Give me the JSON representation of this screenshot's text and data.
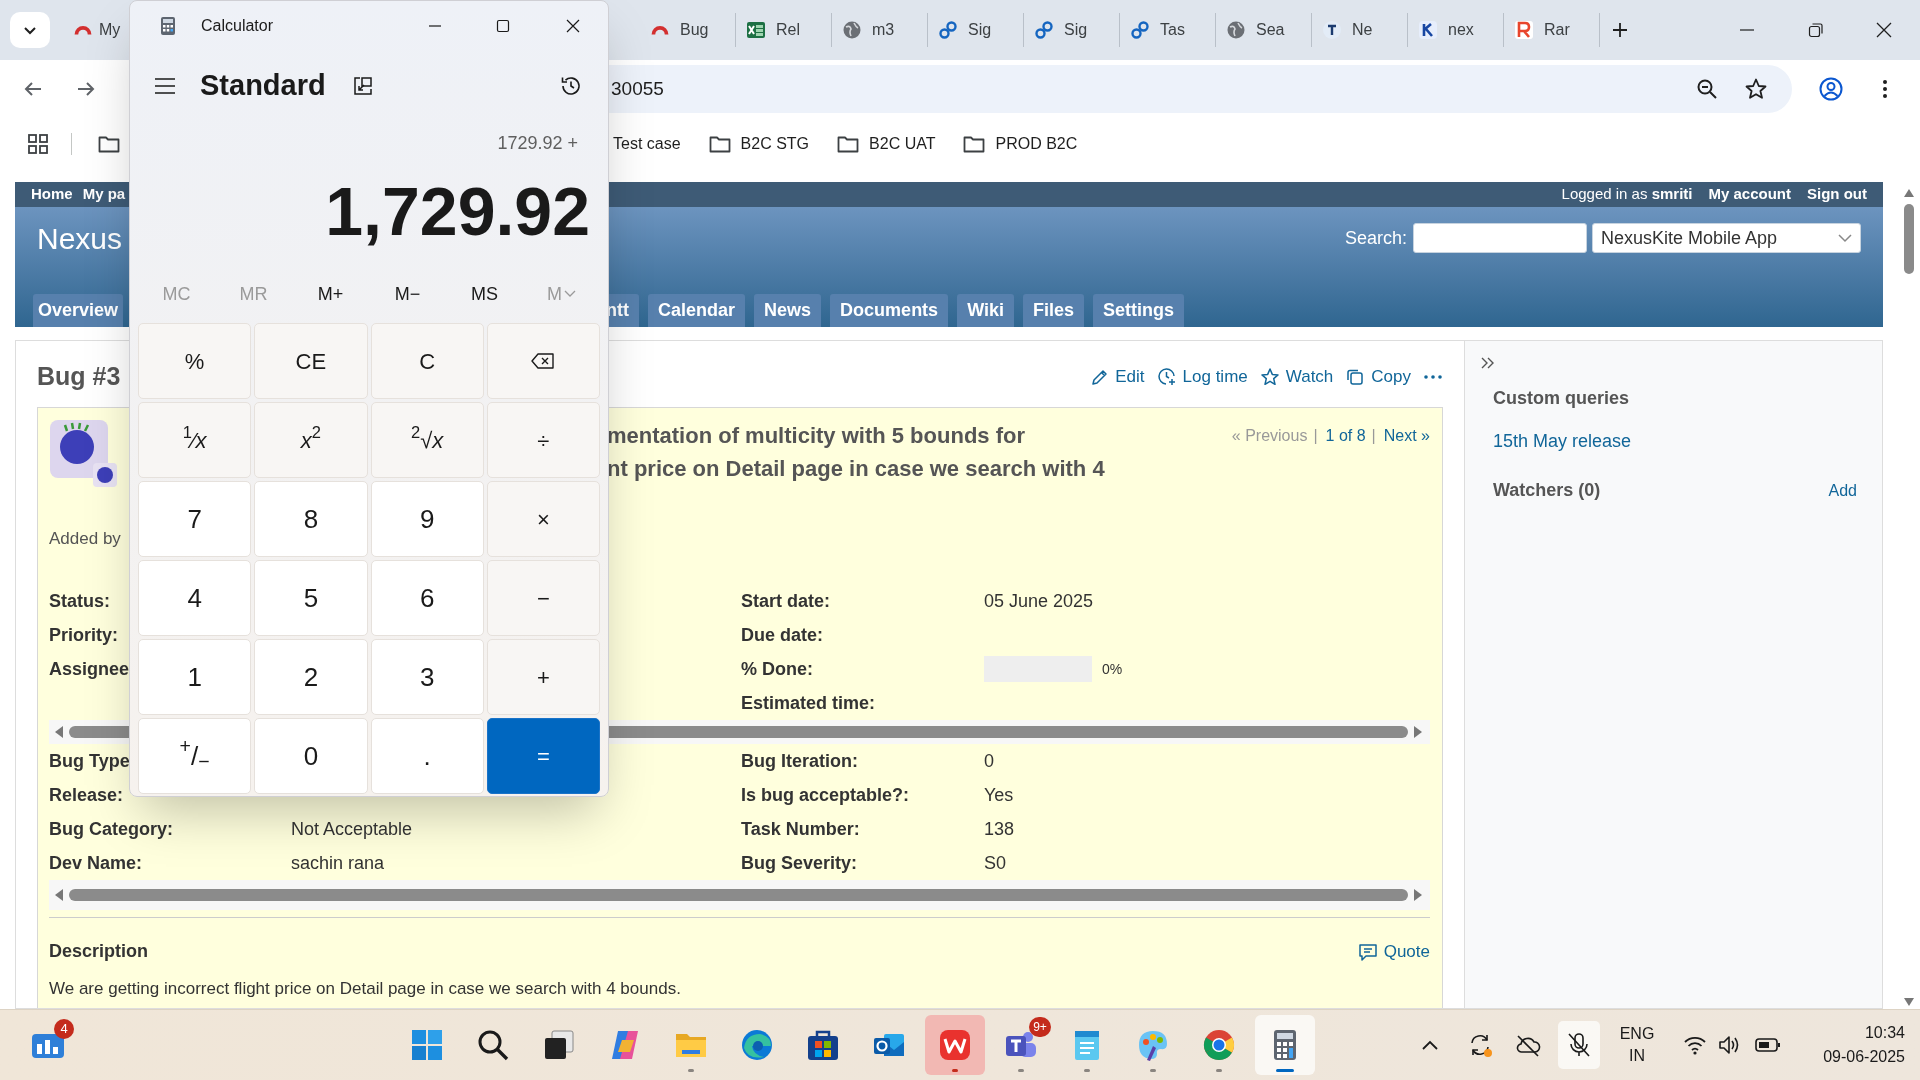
{
  "browser": {
    "tabs": [
      {
        "label": "My",
        "kind": "arch",
        "selected": false
      },
      {
        "label": "Bug",
        "kind": "arch",
        "selected": false
      },
      {
        "label": "Rel",
        "kind": "sheet",
        "selected": false
      },
      {
        "label": "m3",
        "kind": "globe",
        "selected": false
      },
      {
        "label": "Sig",
        "kind": "link",
        "selected": false
      },
      {
        "label": "Sig",
        "kind": "link",
        "selected": false
      },
      {
        "label": "Tas",
        "kind": "link",
        "selected": false
      },
      {
        "label": "Sea",
        "kind": "globe",
        "selected": false
      },
      {
        "label": "Ne",
        "kind": "navy",
        "selected": false
      },
      {
        "label": "nex",
        "kind": "blue",
        "selected": false
      },
      {
        "label": "Rar",
        "kind": "red",
        "selected": false
      }
    ],
    "address": "30055",
    "bookmarks": [
      {
        "label": "Test case",
        "kind": "plain"
      },
      {
        "label": "B2C STG",
        "kind": "folder"
      },
      {
        "label": "B2C UAT",
        "kind": "folder"
      },
      {
        "label": "PROD B2C",
        "kind": "folder"
      }
    ]
  },
  "redmine": {
    "top_menu": [
      "Home",
      "My pa"
    ],
    "logged_in": "Logged in as **smriti**",
    "account_links": [
      "My account",
      "Sign out"
    ],
    "project_title": "Nexus",
    "search_label": "Search:",
    "project_select": "NexusKite Mobile App",
    "tabs": [
      {
        "label": "Overview",
        "selected": false
      },
      {
        "label": "ntt",
        "selected": false
      },
      {
        "label": "Calendar",
        "selected": false
      },
      {
        "label": "News",
        "selected": false
      },
      {
        "label": "Documents",
        "selected": false
      },
      {
        "label": "Wiki",
        "selected": false
      },
      {
        "label": "Files",
        "selected": false
      },
      {
        "label": "Settings",
        "selected": false
      }
    ],
    "issue": {
      "heading": "Bug #3",
      "actions": [
        {
          "label": "Edit",
          "kind": "edit"
        },
        {
          "label": "Log time",
          "kind": "time"
        },
        {
          "label": "Watch",
          "kind": "watch"
        },
        {
          "label": "Copy",
          "kind": "copy"
        }
      ],
      "subject_lines": [
        "mentation of multicity with 5 bounds for",
        "nt price on Detail page in case we search with 4"
      ],
      "pager": [
        {
          "text": "« Previous",
          "kind": "disabled"
        },
        {
          "text": "|",
          "kind": "separator"
        },
        {
          "text": "1 of 8",
          "kind": "link"
        },
        {
          "text": "|",
          "kind": "separator"
        },
        {
          "text": "Next »",
          "kind": "link"
        }
      ],
      "added_by": "Added by",
      "attribute_groups": [
        {
          "left": [
            {
              "label": "Status:"
            },
            {
              "label": "Priority:"
            },
            {
              "label": "Assignee"
            }
          ],
          "right": [
            {
              "label": "Start date:",
              "value": "05 June 2025"
            },
            {
              "label": "Due date:"
            },
            {
              "label": "% Done:",
              "kind": "progress",
              "level": 0,
              "reading": "0%"
            },
            {
              "label": "Estimated time:"
            }
          ]
        },
        {
          "left": [
            {
              "label": "Bug Type"
            },
            {
              "label": "Release:"
            },
            {
              "label": "Bug Category:",
              "value": "Not Acceptable"
            },
            {
              "label": "Dev Name:",
              "value": "sachin rana"
            }
          ],
          "right": [
            {
              "label": "Bug Iteration:",
              "value": "0"
            },
            {
              "label": "Is bug acceptable?:",
              "value": "Yes"
            },
            {
              "label": "Task Number:",
              "value": "138"
            },
            {
              "label": "Bug Severity:",
              "value": "S0"
            }
          ]
        }
      ],
      "description": {
        "title": "Description",
        "quote": "Quote",
        "text": "We are getting incorrect flight price on Detail page in case we search with 4 bounds."
      }
    },
    "sidebar": {
      "queries_title": "Custom queries",
      "queries": [
        "15th May release"
      ],
      "watchers_title": "Watchers (0)",
      "add": "Add"
    }
  },
  "calculator": {
    "title": "Calculator",
    "mode": "Standard",
    "expression": "1729.92 +",
    "display": "1,729.92",
    "memory": [
      {
        "label": "MC",
        "kind": "plain",
        "disabled": true
      },
      {
        "label": "MR",
        "kind": "plain",
        "disabled": true
      },
      {
        "label": "M+",
        "kind": "plain",
        "disabled": false
      },
      {
        "label": "M−",
        "kind": "plain",
        "disabled": false
      },
      {
        "label": "MS",
        "kind": "plain",
        "disabled": false
      },
      {
        "label": "M",
        "kind": "dropdown",
        "disabled": true
      }
    ],
    "keys": [
      {
        "label": "%",
        "kind": "function"
      },
      {
        "label": "CE",
        "kind": "function"
      },
      {
        "label": "C",
        "kind": "function"
      },
      {
        "kind": "backspace"
      },
      {
        "label": "$^{1}$⁄*x*",
        "kind": "function"
      },
      {
        "label": "*x*$^{2}$",
        "kind": "function"
      },
      {
        "label": "$^{2}$√*x*",
        "kind": "function"
      },
      {
        "label": "÷",
        "kind": "function"
      },
      {
        "label": "7",
        "kind": "digit"
      },
      {
        "label": "8",
        "kind": "digit"
      },
      {
        "label": "9",
        "kind": "digit"
      },
      {
        "label": "×",
        "kind": "function"
      },
      {
        "label": "4",
        "kind": "digit"
      },
      {
        "label": "5",
        "kind": "digit"
      },
      {
        "label": "6",
        "kind": "digit"
      },
      {
        "label": "−",
        "kind": "function"
      },
      {
        "label": "1",
        "kind": "digit"
      },
      {
        "label": "2",
        "kind": "digit"
      },
      {
        "label": "3",
        "kind": "digit"
      },
      {
        "label": "+",
        "kind": "function"
      },
      {
        "label": "$^{+}$/$_{−}$",
        "kind": "digit"
      },
      {
        "label": "0",
        "kind": "digit"
      },
      {
        "label": ".",
        "kind": "digit"
      },
      {
        "label": "=",
        "kind": "equals"
      }
    ]
  },
  "taskbar": {
    "widgets_badge": "4",
    "apps": [
      {
        "kind": "start",
        "running": false,
        "selected": false,
        "attention": false
      },
      {
        "kind": "search",
        "running": false,
        "selected": false,
        "attention": false
      },
      {
        "kind": "taskview",
        "running": false,
        "selected": false,
        "attention": false
      },
      {
        "kind": "copilot",
        "running": false,
        "selected": false,
        "attention": false
      },
      {
        "kind": "explorer",
        "running": true,
        "selected": false,
        "attention": false
      },
      {
        "kind": "edge",
        "running": false,
        "selected": false,
        "attention": false
      },
      {
        "kind": "store",
        "running": false,
        "selected": false,
        "attention": false
      },
      {
        "kind": "outlook",
        "running": false,
        "selected": false,
        "attention": false
      },
      {
        "kind": "wps",
        "running": true,
        "selected": false,
        "attention": true
      },
      {
        "kind": "teams",
        "running": true,
        "selected": false,
        "attention": false,
        "badge": "9+"
      },
      {
        "kind": "notepad",
        "running": true,
        "selected": false,
        "attention": false
      },
      {
        "kind": "paint",
        "running": true,
        "selected": false,
        "attention": false
      },
      {
        "kind": "chrome",
        "running": true,
        "selected": false,
        "attention": false
      },
      {
        "kind": "calculator",
        "running": true,
        "selected": true,
        "attention": false
      }
    ],
    "language": "ENG",
    "region": "IN",
    "time": "10:34",
    "date": "09-06-2025"
  }
}
